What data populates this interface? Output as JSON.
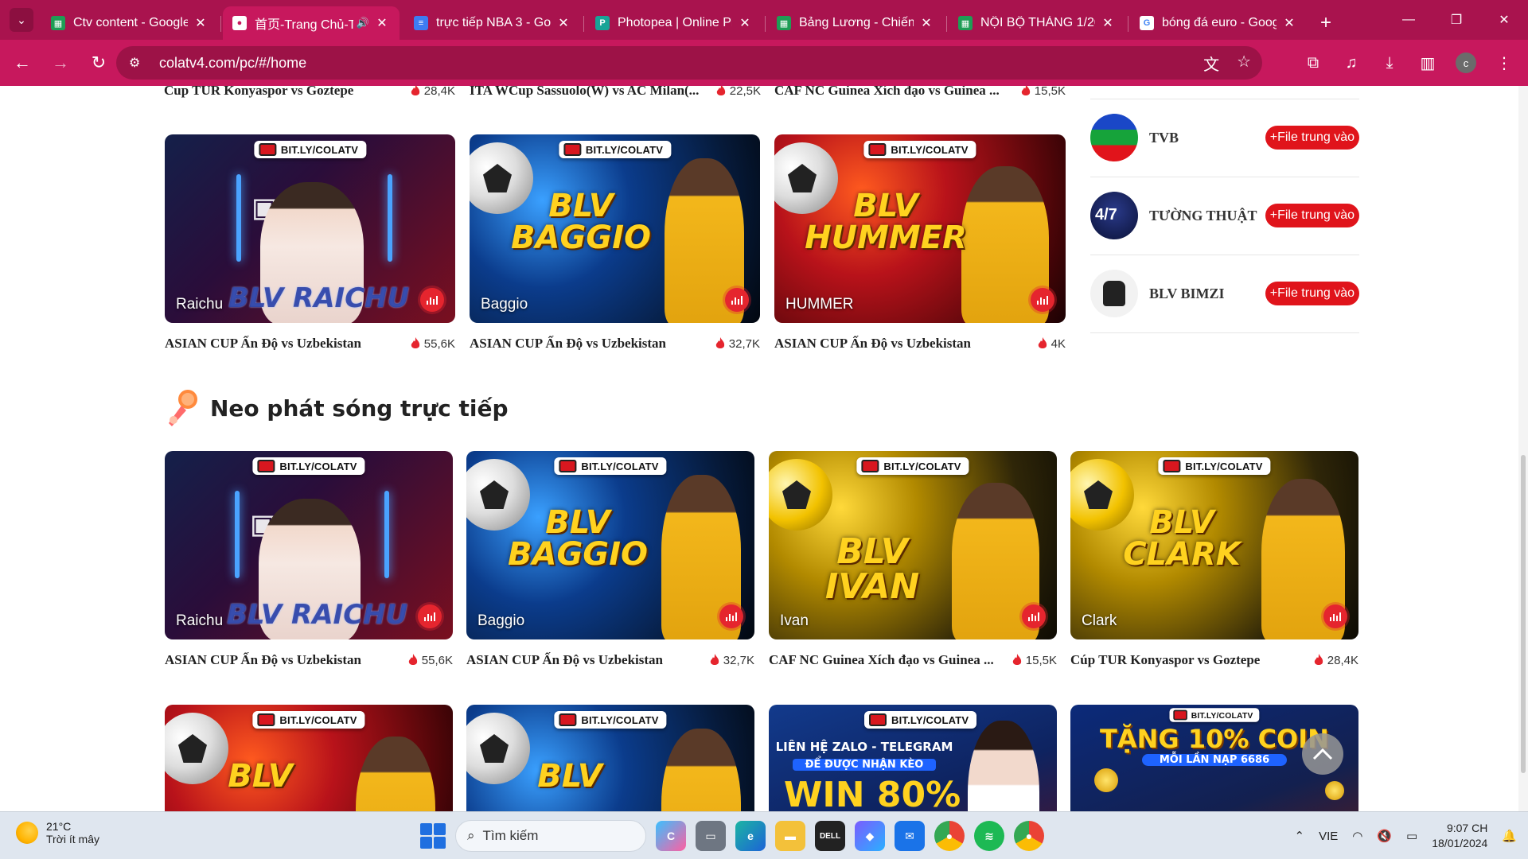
{
  "browser": {
    "tabs": [
      {
        "title": "Ctv content - Google",
        "favicon": "sheets-icon",
        "color": "#1e9d55",
        "active": false
      },
      {
        "title": "首页-Trang Chủ-T",
        "favicon": "colatv-icon",
        "color": "#ffffff",
        "active": true,
        "audio": true
      },
      {
        "title": "trực tiếp NBA 3 - Goo",
        "favicon": "docs-icon",
        "color": "#3d7cf2",
        "active": false
      },
      {
        "title": "Photopea | Online Ph",
        "favicon": "photopea-icon",
        "color": "#18a497",
        "active": false
      },
      {
        "title": "Bảng Lương - Chiến",
        "favicon": "sheets-icon",
        "color": "#1e9d55",
        "active": false
      },
      {
        "title": "NỘI BỘ THÁNG 1/20",
        "favicon": "sheets-icon",
        "color": "#1e9d55",
        "active": false
      },
      {
        "title": "bóng đá euro - Goog",
        "favicon": "google-icon",
        "color": "#ffffff",
        "active": false
      }
    ],
    "url": "colatv4.com/pc/#/home",
    "profile_initial": "c"
  },
  "top_row_captions": [
    {
      "title": "Cup TUR Konyaspor vs Goztepe",
      "views": "28,4K"
    },
    {
      "title": "ITA WCup Sassuolo(W) vs AC Milan(...",
      "views": "22,5K"
    },
    {
      "title": "CAF NC Guinea Xích đạo vs Guinea ...",
      "views": "15,5K"
    }
  ],
  "row1_cards": [
    {
      "name": "Raichu",
      "overlay": "BLV RAICHU",
      "title": "ASIAN CUP Ấn Độ vs Uzbekistan",
      "views": "55,6K"
    },
    {
      "name": "Baggio",
      "overlay": "BLV BAGGIO",
      "title": "ASIAN CUP Ấn Độ vs Uzbekistan",
      "views": "32,7K"
    },
    {
      "name": "HUMMER",
      "overlay": "BLV HUMMER",
      "title": "ASIAN CUP Ấn Độ vs Uzbekistan",
      "views": "4K"
    }
  ],
  "brand_badge": "BIT.LY/COLATV",
  "sidebar": [
    {
      "name": "TVB",
      "button": "+File trung vào"
    },
    {
      "name": "TƯỜNG THUẬT",
      "button": "+File trung vào",
      "logo_text": "4/7"
    },
    {
      "name": "BLV BIMZI",
      "button": "+File trung vào"
    }
  ],
  "section": {
    "title": "Neo phát sóng trực tiếp"
  },
  "row2_cards": [
    {
      "name": "Raichu",
      "overlay": "BLV RAICHU",
      "title": "ASIAN CUP Ấn Độ vs Uzbekistan",
      "views": "55,6K"
    },
    {
      "name": "Baggio",
      "overlay_line1": "BLV",
      "overlay_line2": "BAGGIO",
      "title": "ASIAN CUP Ấn Độ vs Uzbekistan",
      "views": "32,7K"
    },
    {
      "name": "Ivan",
      "overlay_line1": "BLV IVAN",
      "title": "CAF NC Guinea Xích đạo vs Guinea ...",
      "views": "15,5K"
    },
    {
      "name": "Clark",
      "overlay_line1": "BLV",
      "overlay_line2": "CLARK",
      "title": "Cúp TUR Konyaspor vs Goztepe",
      "views": "28,4K"
    }
  ],
  "row3_cards": [
    {
      "overlay": "BLV"
    },
    {
      "overlay": "BLV"
    },
    {
      "line1": "LIÊN HỆ ZALO - TELEGRAM",
      "line2": "ĐỂ ĐƯỢC NHẬN KÈO",
      "line3": "WIN 80%"
    },
    {
      "line1": "TẶNG 10% COIN",
      "line2": "MỖI LẦN NẠP 6686"
    }
  ],
  "taskbar": {
    "temperature": "21°C",
    "weather": "Trời ít mây",
    "search_placeholder": "Tìm kiếm",
    "language": "VIE",
    "time": "9:07 CH",
    "date": "18/01/2024"
  },
  "colors": {
    "accent": "#c7185d",
    "live_red": "#e5252e",
    "follow_red": "#e0141b"
  }
}
